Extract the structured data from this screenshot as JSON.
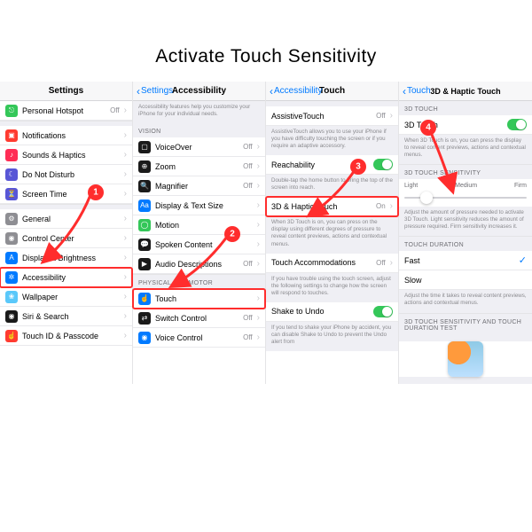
{
  "title": "Activate Touch Sensitivity",
  "p1": {
    "header": "Settings",
    "items_a": [
      {
        "label": "Personal Hotspot",
        "val": "Off",
        "ico": "#34c759",
        "glyph": "⎋"
      }
    ],
    "items_b": [
      {
        "label": "Notifications",
        "ico": "#ff3b30",
        "glyph": "▣"
      },
      {
        "label": "Sounds & Haptics",
        "ico": "#ff2d55",
        "glyph": "♪"
      },
      {
        "label": "Do Not Disturb",
        "ico": "#5856d6",
        "glyph": "☾"
      },
      {
        "label": "Screen Time",
        "ico": "#5856d6",
        "glyph": "⏳"
      }
    ],
    "items_c": [
      {
        "label": "General",
        "ico": "#8e8e93",
        "glyph": "⚙"
      },
      {
        "label": "Control Center",
        "ico": "#8e8e93",
        "glyph": "◉"
      },
      {
        "label": "Display & Brightness",
        "ico": "#007aff",
        "glyph": "A"
      },
      {
        "label": "Accessibility",
        "ico": "#007aff",
        "glyph": "✲",
        "hl": true
      },
      {
        "label": "Wallpaper",
        "ico": "#5ac8fa",
        "glyph": "❀"
      },
      {
        "label": "Siri & Search",
        "ico": "#1a1a1a",
        "glyph": "◉"
      },
      {
        "label": "Touch ID & Passcode",
        "ico": "#ff3b30",
        "glyph": "☝"
      }
    ]
  },
  "p2": {
    "back": "Settings",
    "header": "Accessibility",
    "intro": "Accessibility features help you customize your iPhone for your individual needs.",
    "grp_vision": "VISION",
    "vision": [
      {
        "label": "VoiceOver",
        "val": "Off",
        "ico": "#1a1a1a",
        "glyph": "▢"
      },
      {
        "label": "Zoom",
        "val": "Off",
        "ico": "#1a1a1a",
        "glyph": "⊕"
      },
      {
        "label": "Magnifier",
        "val": "Off",
        "ico": "#1a1a1a",
        "glyph": "🔍"
      },
      {
        "label": "Display & Text Size",
        "ico": "#007aff",
        "glyph": "Aa"
      },
      {
        "label": "Motion",
        "ico": "#34c759",
        "glyph": "◯"
      },
      {
        "label": "Spoken Content",
        "ico": "#1a1a1a",
        "glyph": "💬"
      },
      {
        "label": "Audio Descriptions",
        "val": "Off",
        "ico": "#1a1a1a",
        "glyph": "▶"
      }
    ],
    "grp_motor": "PHYSICAL AND MOTOR",
    "motor": [
      {
        "label": "Touch",
        "ico": "#007aff",
        "glyph": "☝",
        "hl": true
      },
      {
        "label": "Switch Control",
        "val": "Off",
        "ico": "#1a1a1a",
        "glyph": "⇄"
      },
      {
        "label": "Voice Control",
        "val": "Off",
        "ico": "#007aff",
        "glyph": "◉"
      }
    ]
  },
  "p3": {
    "back": "Accessibility",
    "header": "Touch",
    "at_label": "AssistiveTouch",
    "at_val": "Off",
    "at_note": "AssistiveTouch allows you to use your iPhone if you have difficulty touching the screen or if you require an adaptive accessory.",
    "reach_label": "Reachability",
    "reach_note": "Double-tap the home button to bring the top of the screen into reach.",
    "haptic_label": "3D & Haptic Touch",
    "haptic_val": "On",
    "haptic_note": "When 3D Touch is on, you can press on the display using different degrees of pressure to reveal content previews, actions and contextual menus.",
    "ta_label": "Touch Accommodations",
    "ta_val": "Off",
    "ta_note": "If you have trouble using the touch screen, adjust the following settings to change how the screen will respond to touches.",
    "shake_label": "Shake to Undo",
    "shake_note": "If you tend to shake your iPhone by accident, you can disable Shake to Undo to prevent the Undo alert from"
  },
  "p4": {
    "back": "Touch",
    "header": "3D & Haptic Touch",
    "grp1": "3D TOUCH",
    "t1": "3D Touch",
    "t1_note": "When 3D Touch is on, you can press the display to reveal content previews, actions and contextual menus.",
    "grp2": "3D TOUCH SENSITIVITY",
    "s_light": "Light",
    "s_med": "Medium",
    "s_firm": "Firm",
    "s_note": "Adjust the amount of pressure needed to activate 3D Touch. Light sensitivity reduces the amount of pressure required. Firm sensitivity increases it.",
    "grp3": "TOUCH DURATION",
    "d_fast": "Fast",
    "d_slow": "Slow",
    "d_note": "Adjust the time it takes to reveal content previews, actions and contextual menus.",
    "grp4": "3D TOUCH SENSITIVITY AND TOUCH DURATION TEST"
  }
}
